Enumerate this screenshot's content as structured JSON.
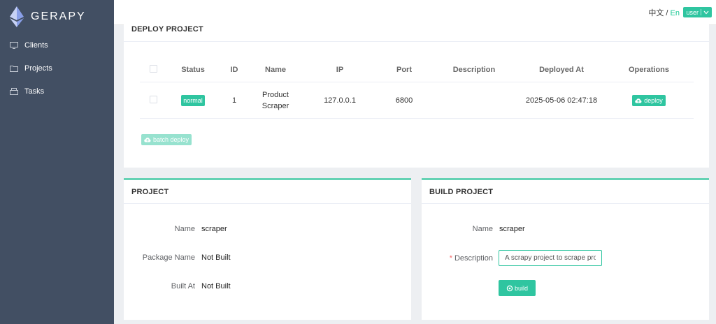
{
  "app": {
    "name": "GERAPY"
  },
  "sidebar": {
    "items": [
      {
        "label": "Clients",
        "icon": "monitor-icon"
      },
      {
        "label": "Projects",
        "icon": "folder-icon"
      },
      {
        "label": "Tasks",
        "icon": "tasks-icon"
      }
    ]
  },
  "header": {
    "lang_zh": "中文",
    "lang_sep": "/",
    "lang_en": "En",
    "user_label": "user"
  },
  "deploy": {
    "title": "DEPLOY PROJECT",
    "columns": [
      "Status",
      "ID",
      "Name",
      "IP",
      "Port",
      "Description",
      "Deployed At",
      "Operations"
    ],
    "rows": [
      {
        "status": "normal",
        "id": "1",
        "name": "Product Scraper",
        "ip": "127.0.0.1",
        "port": "6800",
        "description": "",
        "deployed_at": "2025-05-06 02:47:18",
        "action": "deploy"
      }
    ],
    "batch_label": "batch deploy"
  },
  "project": {
    "title": "PROJECT",
    "fields": [
      {
        "label": "Name",
        "value": "scraper"
      },
      {
        "label": "Package Name",
        "value": "Not Built"
      },
      {
        "label": "Built At",
        "value": "Not Built"
      }
    ]
  },
  "build": {
    "title": "BUILD PROJECT",
    "name_label": "Name",
    "name_value": "scraper",
    "desc_label": "Description",
    "desc_value": "A scrapy project to scrape products",
    "build_label": "build"
  },
  "colors": {
    "accent": "#2fc5a0",
    "sidebar": "#424f63",
    "accent_light": "#97e2cf"
  }
}
